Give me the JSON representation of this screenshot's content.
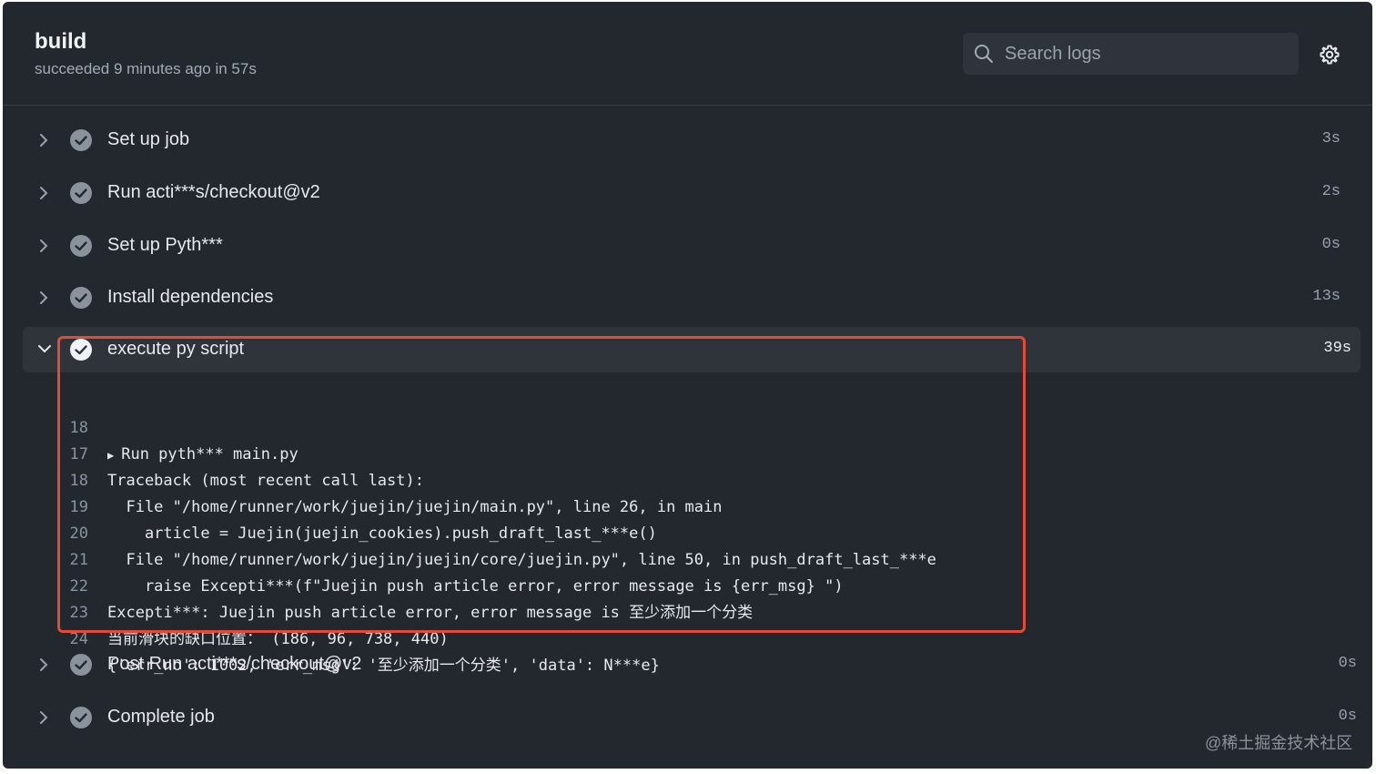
{
  "header": {
    "title": "build",
    "subtitle": "succeeded 9 minutes ago in 57s",
    "search_placeholder": "Search logs"
  },
  "steps": [
    {
      "name": "Set up job",
      "duration": "3s"
    },
    {
      "name": "Run acti***s/checkout@v2",
      "duration": "2s"
    },
    {
      "name": "Set up Pyth***",
      "duration": "0s"
    },
    {
      "name": "Install dependencies",
      "duration": "13s"
    },
    {
      "name": "execute py script",
      "duration": "39s"
    },
    {
      "name": "Post Run acti***s/checkout@v2",
      "duration": "0s"
    },
    {
      "name": "Complete job",
      "duration": "0s"
    }
  ],
  "log_lines": [
    {
      "num": "18",
      "text": "Run pyth*** main.py"
    },
    {
      "num": "17",
      "text": "Traceback (most recent call last):"
    },
    {
      "num": "18",
      "text": "  File \"/home/runner/work/juejin/juejin/main.py\", line 26, in main"
    },
    {
      "num": "19",
      "text": "    article = Juejin(juejin_cookies).push_draft_last_***e()"
    },
    {
      "num": "20",
      "text": "  File \"/home/runner/work/juejin/juejin/core/juejin.py\", line 50, in push_draft_last_***e"
    },
    {
      "num": "21",
      "text": "    raise Excepti***(f\"Juejin push article error, error message is {err_msg} \")"
    },
    {
      "num": "22",
      "text": "Excepti***: Juejin push article error, error message is 至少添加一个分类"
    },
    {
      "num": "23",
      "text": "当前滑块的缺口位置： (186, 96, 738, 440)"
    },
    {
      "num": "24",
      "text": "{'err_no': 1002, 'err_msg': '至少添加一个分类', 'data': N***e}"
    }
  ],
  "watermark": "@稀土掘金技术社区",
  "colors": {
    "background": "#23272e",
    "highlight_border": "#e34b35",
    "check_circle": "#8b929c"
  }
}
